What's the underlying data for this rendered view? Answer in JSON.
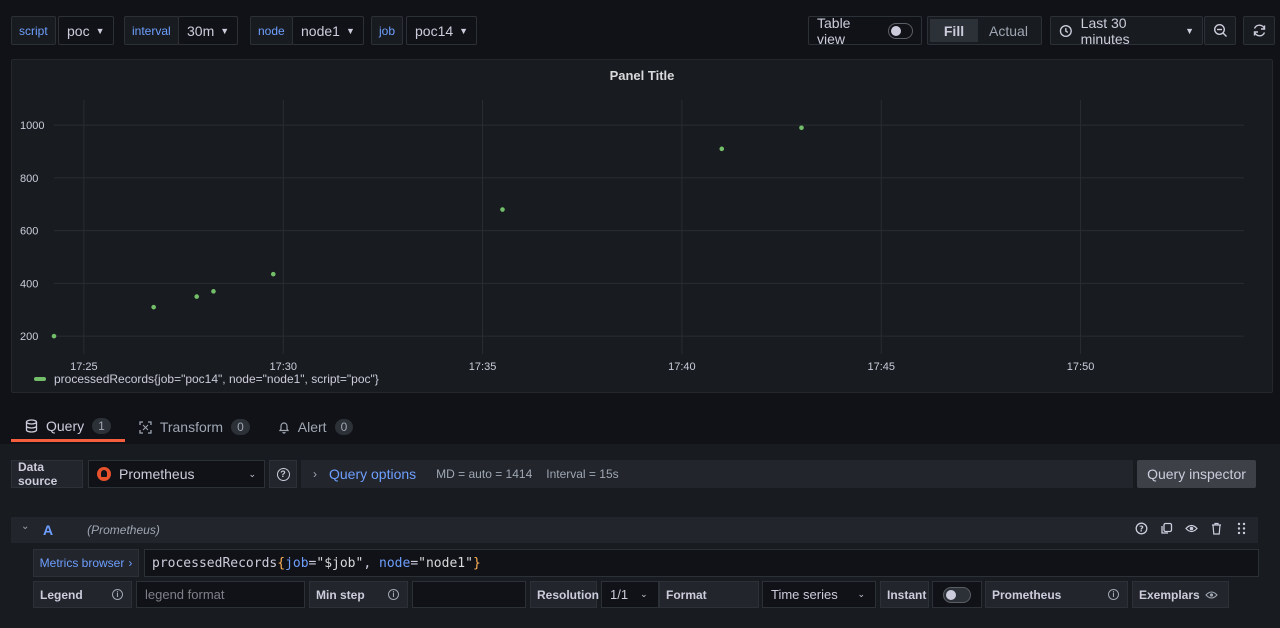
{
  "toolbar": {
    "vars": [
      {
        "label": "script",
        "value": "poc"
      },
      {
        "label": "interval",
        "value": "30m"
      },
      {
        "label": "node",
        "value": "node1"
      },
      {
        "label": "job",
        "value": "poc14"
      }
    ],
    "table_view_label": "Table view",
    "fill_label": "Fill",
    "actual_label": "Actual",
    "time_range": "Last 30 minutes"
  },
  "panel": {
    "title": "Panel Title",
    "legend": "processedRecords{job=\"poc14\", node=\"node1\", script=\"poc\"}"
  },
  "chart_data": {
    "type": "scatter",
    "title": "Panel Title",
    "x_ticks": [
      "17:25",
      "17:30",
      "17:35",
      "17:40",
      "17:45",
      "17:50"
    ],
    "y_ticks": [
      200,
      400,
      600,
      800,
      1000
    ],
    "ylim": [
      140,
      1080
    ],
    "xlim_minutes": [
      24.25,
      54.1
    ],
    "x": [
      "17:24:15",
      "17:26:45",
      "17:27:50",
      "17:28:15",
      "17:29:45",
      "17:35:30",
      "17:41:00",
      "17:43:00"
    ],
    "x_minutes": [
      24.25,
      26.75,
      27.83,
      28.25,
      29.75,
      35.5,
      41.0,
      43.0
    ],
    "values": [
      200,
      310,
      350,
      370,
      435,
      680,
      910,
      990
    ],
    "series": [
      {
        "name": "processedRecords{job=\"poc14\", node=\"node1\", script=\"poc\"}",
        "color": "#73bf69"
      }
    ],
    "grid": true,
    "legend_position": "bottom-left"
  },
  "query_tabs": [
    {
      "label": "Query",
      "count": "1"
    },
    {
      "label": "Transform",
      "count": "0"
    },
    {
      "label": "Alert",
      "count": "0"
    }
  ],
  "datasource": {
    "label": "Data source",
    "value": "Prometheus",
    "query_options": "Query options",
    "md": "MD = auto = 1414",
    "interval": "Interval = 15s",
    "inspector": "Query inspector"
  },
  "query_row": {
    "ref": "A",
    "ds": "(Prometheus)",
    "metrics_browser": "Metrics browser",
    "expr_metric": "processedRecords",
    "expr_open": "{",
    "expr_k1": "job",
    "expr_eq1": "=",
    "expr_v1": "\"$job\"",
    "expr_sep": ", ",
    "expr_k2": "node",
    "expr_eq2": "=",
    "expr_v2": "\"node1\"",
    "expr_close": "}"
  },
  "options": {
    "legend_label": "Legend",
    "legend_placeholder": "legend format",
    "min_step_label": "Min step",
    "resolution_label": "Resolution",
    "resolution_value": "1/1",
    "format_label": "Format",
    "format_value": "Time series",
    "instant_label": "Instant",
    "prometheus_label": "Prometheus",
    "exemplars_label": "Exemplars"
  }
}
